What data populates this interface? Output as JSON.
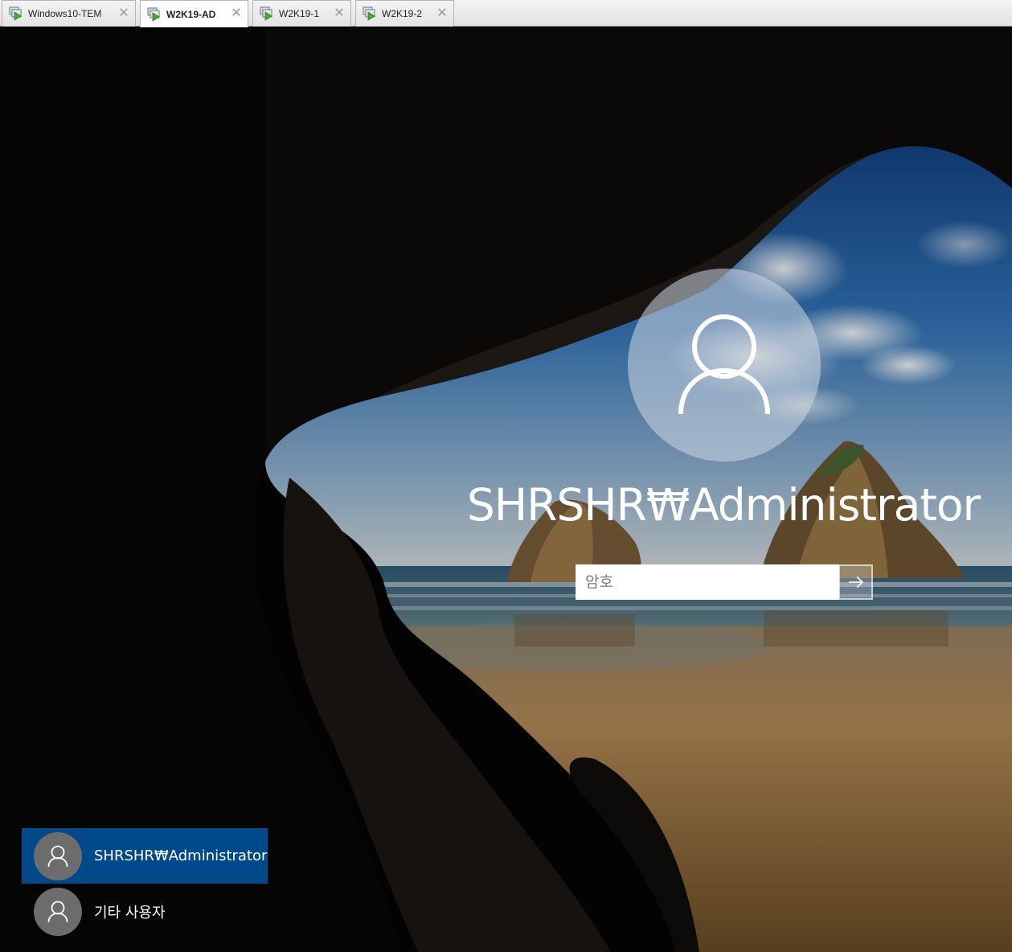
{
  "tabs": [
    {
      "label": "Windows10-TEM",
      "active": false
    },
    {
      "label": "W2K19-AD",
      "active": true
    },
    {
      "label": "W2K19-1",
      "active": false
    },
    {
      "label": "W2K19-2",
      "active": false
    }
  ],
  "icons": {
    "vm": "vm-running-icon",
    "close": "close-icon",
    "user": "user-icon",
    "arrow": "arrow-right-icon"
  },
  "lock_screen": {
    "username": "SHRSHR₩Administrator",
    "password_placeholder": "암호"
  },
  "user_list": [
    {
      "name": "SHRSHR₩Administrator",
      "selected": true
    },
    {
      "name": "기타 사용자",
      "selected": false
    }
  ],
  "colors": {
    "selected_user_bg": "#004a8b",
    "sky": "#2f6fb0",
    "sand": "#b08650"
  }
}
